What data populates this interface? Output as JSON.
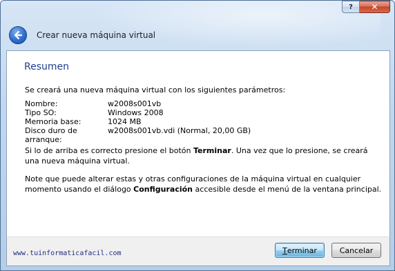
{
  "window": {
    "help_label": "?",
    "close_label": "✕"
  },
  "header": {
    "title": "Crear nueva máquina virtual",
    "back_icon": "back-arrow-icon"
  },
  "panel": {
    "title": "Resumen",
    "intro": "Se creará una nueva máquina virtual con los siguientes parámetros:",
    "summary": [
      {
        "label": "Nombre:",
        "value": "w2008s001vb"
      },
      {
        "label": "Tipo SO:",
        "value": "Windows 2008"
      },
      {
        "label": "Memoria base:",
        "value": "1024 MB"
      },
      {
        "label": "Disco duro de arranque:",
        "value": "w2008s001vb.vdi (Normal, 20,00 GB)"
      }
    ],
    "p1_before": "Si lo de arriba es correcto presione el botón ",
    "p1_bold": "Terminar",
    "p1_after": ". Una vez que lo presione, se creará una nueva máquina virtual.",
    "p2_before": "Note que puede alterar estas y otras configuraciones de la máquina virtual en cualquier momento usando el diálogo ",
    "p2_bold": "Configuración",
    "p2_after": " accesible desde el menú de la ventana principal."
  },
  "footer": {
    "watermark": "www.tuinformaticafacil.com",
    "finish_prefix": "T",
    "finish_rest": "erminar",
    "cancel_label": "Cancelar"
  }
}
